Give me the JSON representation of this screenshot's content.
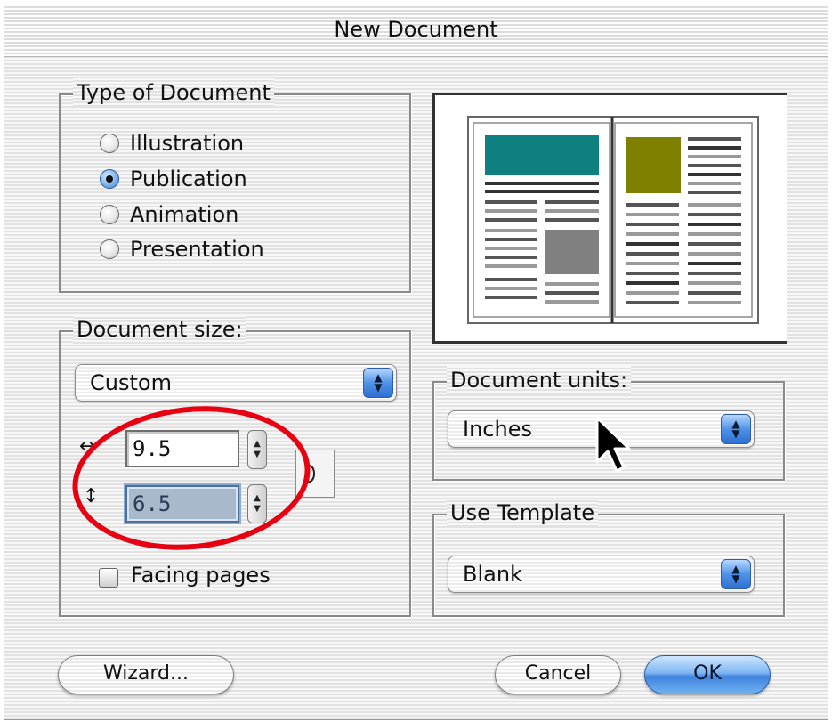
{
  "window": {
    "title": "New Document"
  },
  "type_of_document": {
    "legend": "Type of Document",
    "options": [
      {
        "label": "Illustration",
        "checked": false
      },
      {
        "label": "Publication",
        "checked": true
      },
      {
        "label": "Animation",
        "checked": false
      },
      {
        "label": "Presentation",
        "checked": false
      }
    ]
  },
  "document_size": {
    "legend": "Document size:",
    "preset": "Custom",
    "width_value": "9.5",
    "height_value": "6.5",
    "facing_pages_label": "Facing pages",
    "facing_pages_checked": false
  },
  "document_units": {
    "legend": "Document units:",
    "selected": "Inches"
  },
  "use_template": {
    "legend": "Use Template",
    "selected": "Blank"
  },
  "buttons": {
    "wizard": "Wizard...",
    "cancel": "Cancel",
    "ok": "OK"
  },
  "colors": {
    "preview_header_block": "#0e8080",
    "preview_photo_left": "#808080",
    "preview_photo_right": "#808000",
    "annotation_ring": "#e60012",
    "default_button_blue": "#3f82dc"
  },
  "icons": {
    "popup_arrows": "up-down-arrows-icon",
    "stepper": "stepper-icon",
    "width_arrow": "horizontal-arrow-icon",
    "height_arrow": "vertical-arrow-icon",
    "constrain": "constrain-proportions-icon",
    "cursor": "mouse-pointer-icon"
  }
}
